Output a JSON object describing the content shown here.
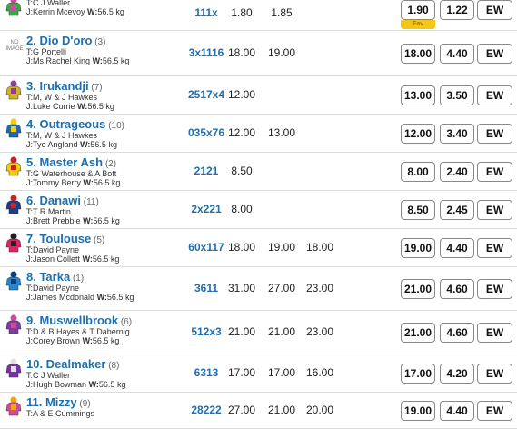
{
  "runners": [
    {
      "name": "",
      "draw": "",
      "trainer": "C J Waller",
      "jockey": "Kerrin Mcevoy",
      "weight": "56.5 kg",
      "form": "111x",
      "o1": "1.80",
      "o2": "1.85",
      "o3": "",
      "win": "1.90",
      "place": "1.22",
      "ew": "EW",
      "fav": "Fav"
    },
    {
      "name": "2. Dio D'oro",
      "draw": "(3)",
      "trainer": "G Portelli",
      "jockey": "Ms Rachel King",
      "weight": "56.5 kg",
      "form": "3x1116",
      "o1": "18.00",
      "o2": "19.00",
      "o3": "",
      "win": "18.00",
      "place": "4.40",
      "ew": "EW",
      "noimage": "NO IMAGE"
    },
    {
      "name": "3. Irukandji",
      "draw": "(7)",
      "trainer": "M, W & J Hawkes",
      "jockey": "Luke Currie",
      "weight": "56.5 kg",
      "form": "2517x4",
      "o1": "12.00",
      "o2": "",
      "o3": "",
      "win": "13.00",
      "place": "3.50",
      "ew": "EW"
    },
    {
      "name": "4. Outrageous",
      "draw": "(10)",
      "trainer": "M, W & J Hawkes",
      "jockey": "Tye Angland",
      "weight": "56.5 kg",
      "form": "035x76",
      "o1": "12.00",
      "o2": "13.00",
      "o3": "",
      "win": "12.00",
      "place": "3.40",
      "ew": "EW"
    },
    {
      "name": "5. Master Ash",
      "draw": "(2)",
      "trainer": "G Waterhouse & A Bott",
      "jockey": "Tommy Berry",
      "weight": "56.5 kg",
      "form": "2121",
      "o1": "8.50",
      "o2": "",
      "o3": "",
      "win": "8.00",
      "place": "2.40",
      "ew": "EW"
    },
    {
      "name": "6. Danawi",
      "draw": "(11)",
      "trainer": "T R Martin",
      "jockey": "Brett Prebble",
      "weight": "56.5 kg",
      "form": "2x221",
      "o1": "8.00",
      "o2": "",
      "o3": "",
      "win": "8.50",
      "place": "2.45",
      "ew": "EW"
    },
    {
      "name": "7. Toulouse",
      "draw": "(5)",
      "trainer": "David Payne",
      "jockey": "Jason Collett",
      "weight": "56.5 kg",
      "form": "60x117",
      "o1": "18.00",
      "o2": "19.00",
      "o3": "18.00",
      "win": "19.00",
      "place": "4.40",
      "ew": "EW"
    },
    {
      "name": "8. Tarka",
      "draw": "(1)",
      "trainer": "David Payne",
      "jockey": "James Mcdonald",
      "weight": "56.5 kg",
      "form": "3611",
      "o1": "31.00",
      "o2": "27.00",
      "o3": "23.00",
      "win": "21.00",
      "place": "4.60",
      "ew": "EW"
    },
    {
      "name": "9. Muswellbrook",
      "draw": "(6)",
      "trainer": "D & B Hayes & T Dabernig",
      "jockey": "Corey Brown",
      "weight": "56.5 kg",
      "form": "512x3",
      "o1": "21.00",
      "o2": "21.00",
      "o3": "23.00",
      "win": "21.00",
      "place": "4.60",
      "ew": "EW"
    },
    {
      "name": "10. Dealmaker",
      "draw": "(8)",
      "trainer": "C J Waller",
      "jockey": "Hugh Bowman",
      "weight": "56.5 kg",
      "form": "6313",
      "o1": "17.00",
      "o2": "17.00",
      "o3": "16.00",
      "win": "17.00",
      "place": "4.20",
      "ew": "EW"
    },
    {
      "name": "11. Mizzy",
      "draw": "(9)",
      "trainer": "A & E Cummings",
      "jockey": "",
      "weight": "",
      "form": "28222",
      "o1": "27.00",
      "o2": "21.00",
      "o3": "20.00",
      "win": "19.00",
      "place": "4.40",
      "ew": "EW"
    }
  ],
  "labels": {
    "t": "T:",
    "j": "J:",
    "w": "W:"
  },
  "colors": {
    "link": "#1f6fb0",
    "fav": "#f5c518"
  }
}
